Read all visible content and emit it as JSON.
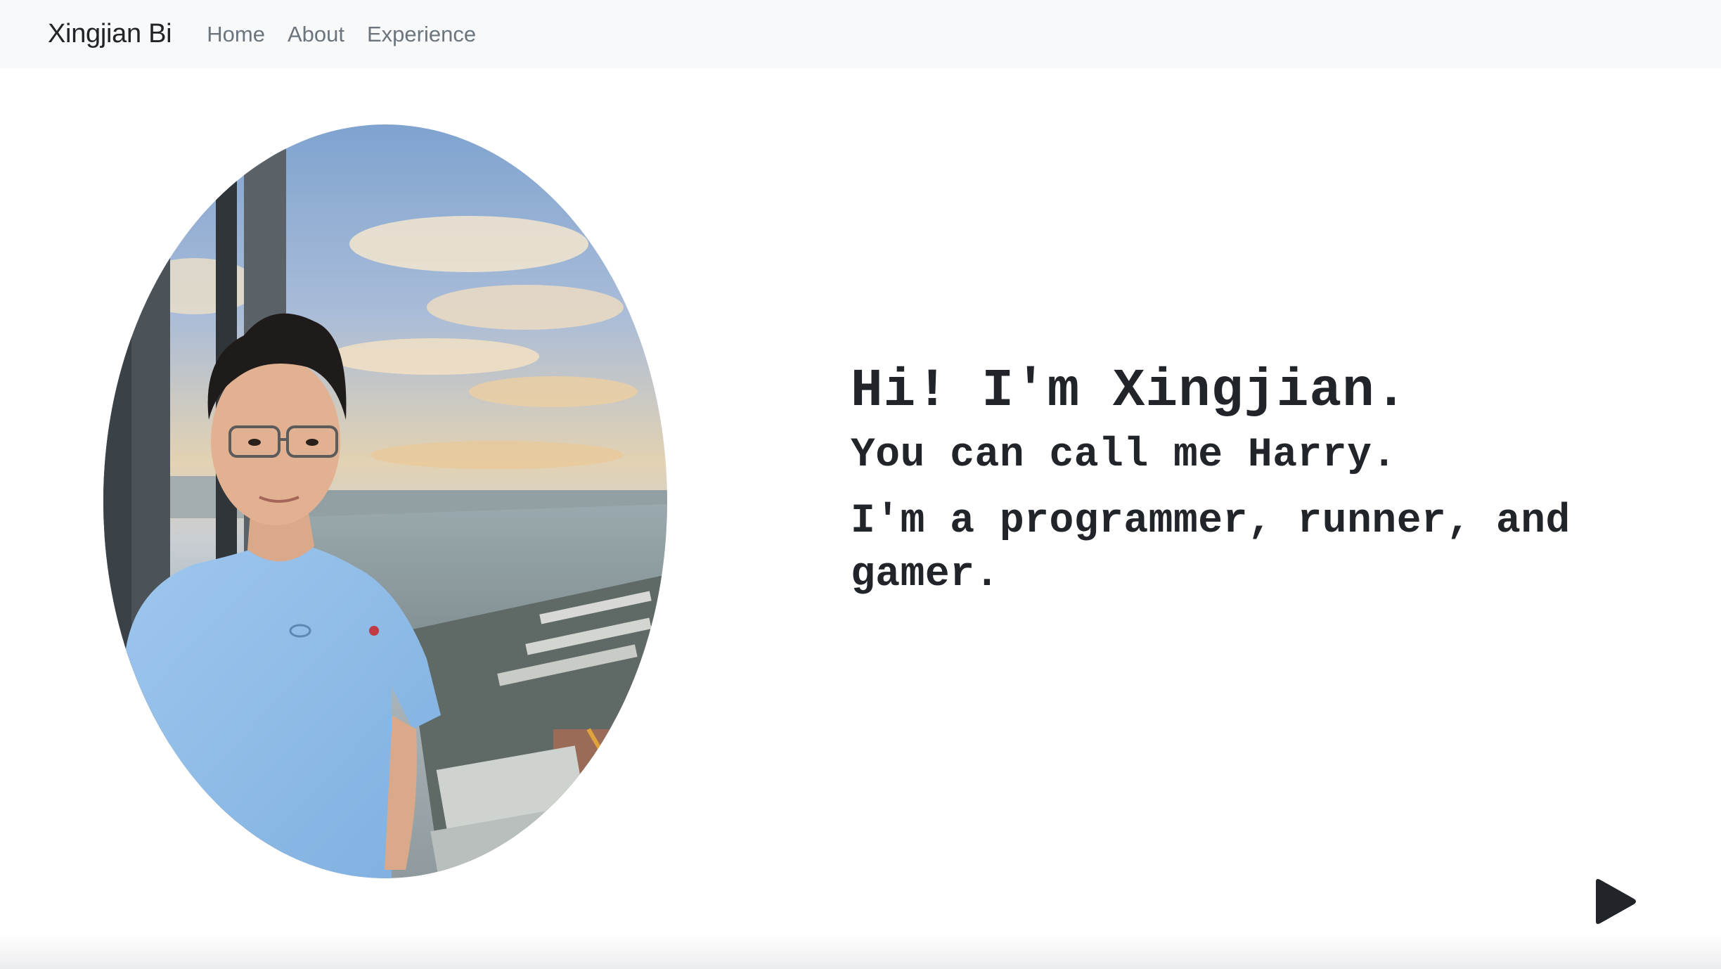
{
  "navbar": {
    "brand": "Xingjian Bi",
    "links": [
      {
        "label": "Home"
      },
      {
        "label": "About"
      },
      {
        "label": "Experience"
      }
    ]
  },
  "hero": {
    "title": "Hi! I'm Xingjian.",
    "lines": [
      "You can call me Harry.",
      "I'm a programmer, runner, and gamer."
    ],
    "photo_icon": "profile-photo"
  },
  "controls": {
    "play_icon": "play-icon"
  },
  "colors": {
    "navbar_bg": "#f8f9fa",
    "brand_text": "#212529",
    "nav_link_text": "#6c757d",
    "body_text": "#212529",
    "play_icon": "#212529"
  }
}
